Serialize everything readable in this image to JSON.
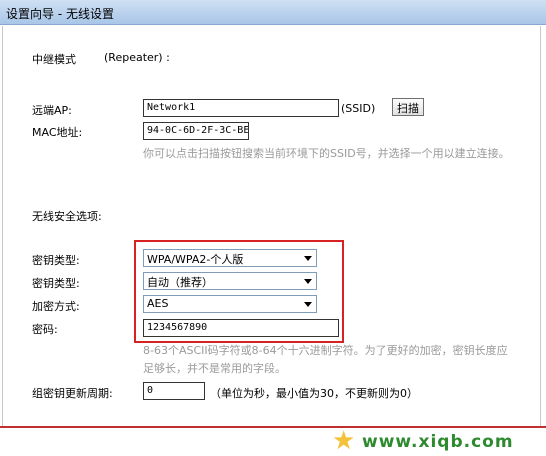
{
  "window": {
    "title": "设置向导 - 无线设置"
  },
  "repeater": {
    "label": "中继模式",
    "mode": "(Repeater) :"
  },
  "remote_ap": {
    "label": "远端AP:",
    "ssid_value": "Network1",
    "ssid_suffix": "(SSID)",
    "scan_button": "扫描"
  },
  "mac": {
    "label": "MAC地址:",
    "value": "94-0C-6D-2F-3C-BE"
  },
  "scan_hint": "你可以点击扫描按钮搜索当前环境下的SSID号，并选择一个用以建立连接。",
  "security": {
    "section_label": "无线安全选项:",
    "key_type_label": "密钥类型:",
    "key_type_value": "WPA/WPA2-个人版",
    "key_type2_label": "密钥类型:",
    "key_type2_value": "自动（推荐）",
    "encryption_label": "加密方式:",
    "encryption_value": "AES",
    "password_label": "密码:",
    "password_value": "1234567890",
    "password_hint": "8-63个ASCII码字符或8-64个十六进制字符。为了更好的加密，密钥长度应足够长，并不是常用的字段。"
  },
  "group_key": {
    "label": "组密钥更新周期:",
    "value": "0",
    "note": "（单位为秒，最小值为30，不更新则为0）"
  },
  "watermark": {
    "text": "www.xiqb.com"
  }
}
